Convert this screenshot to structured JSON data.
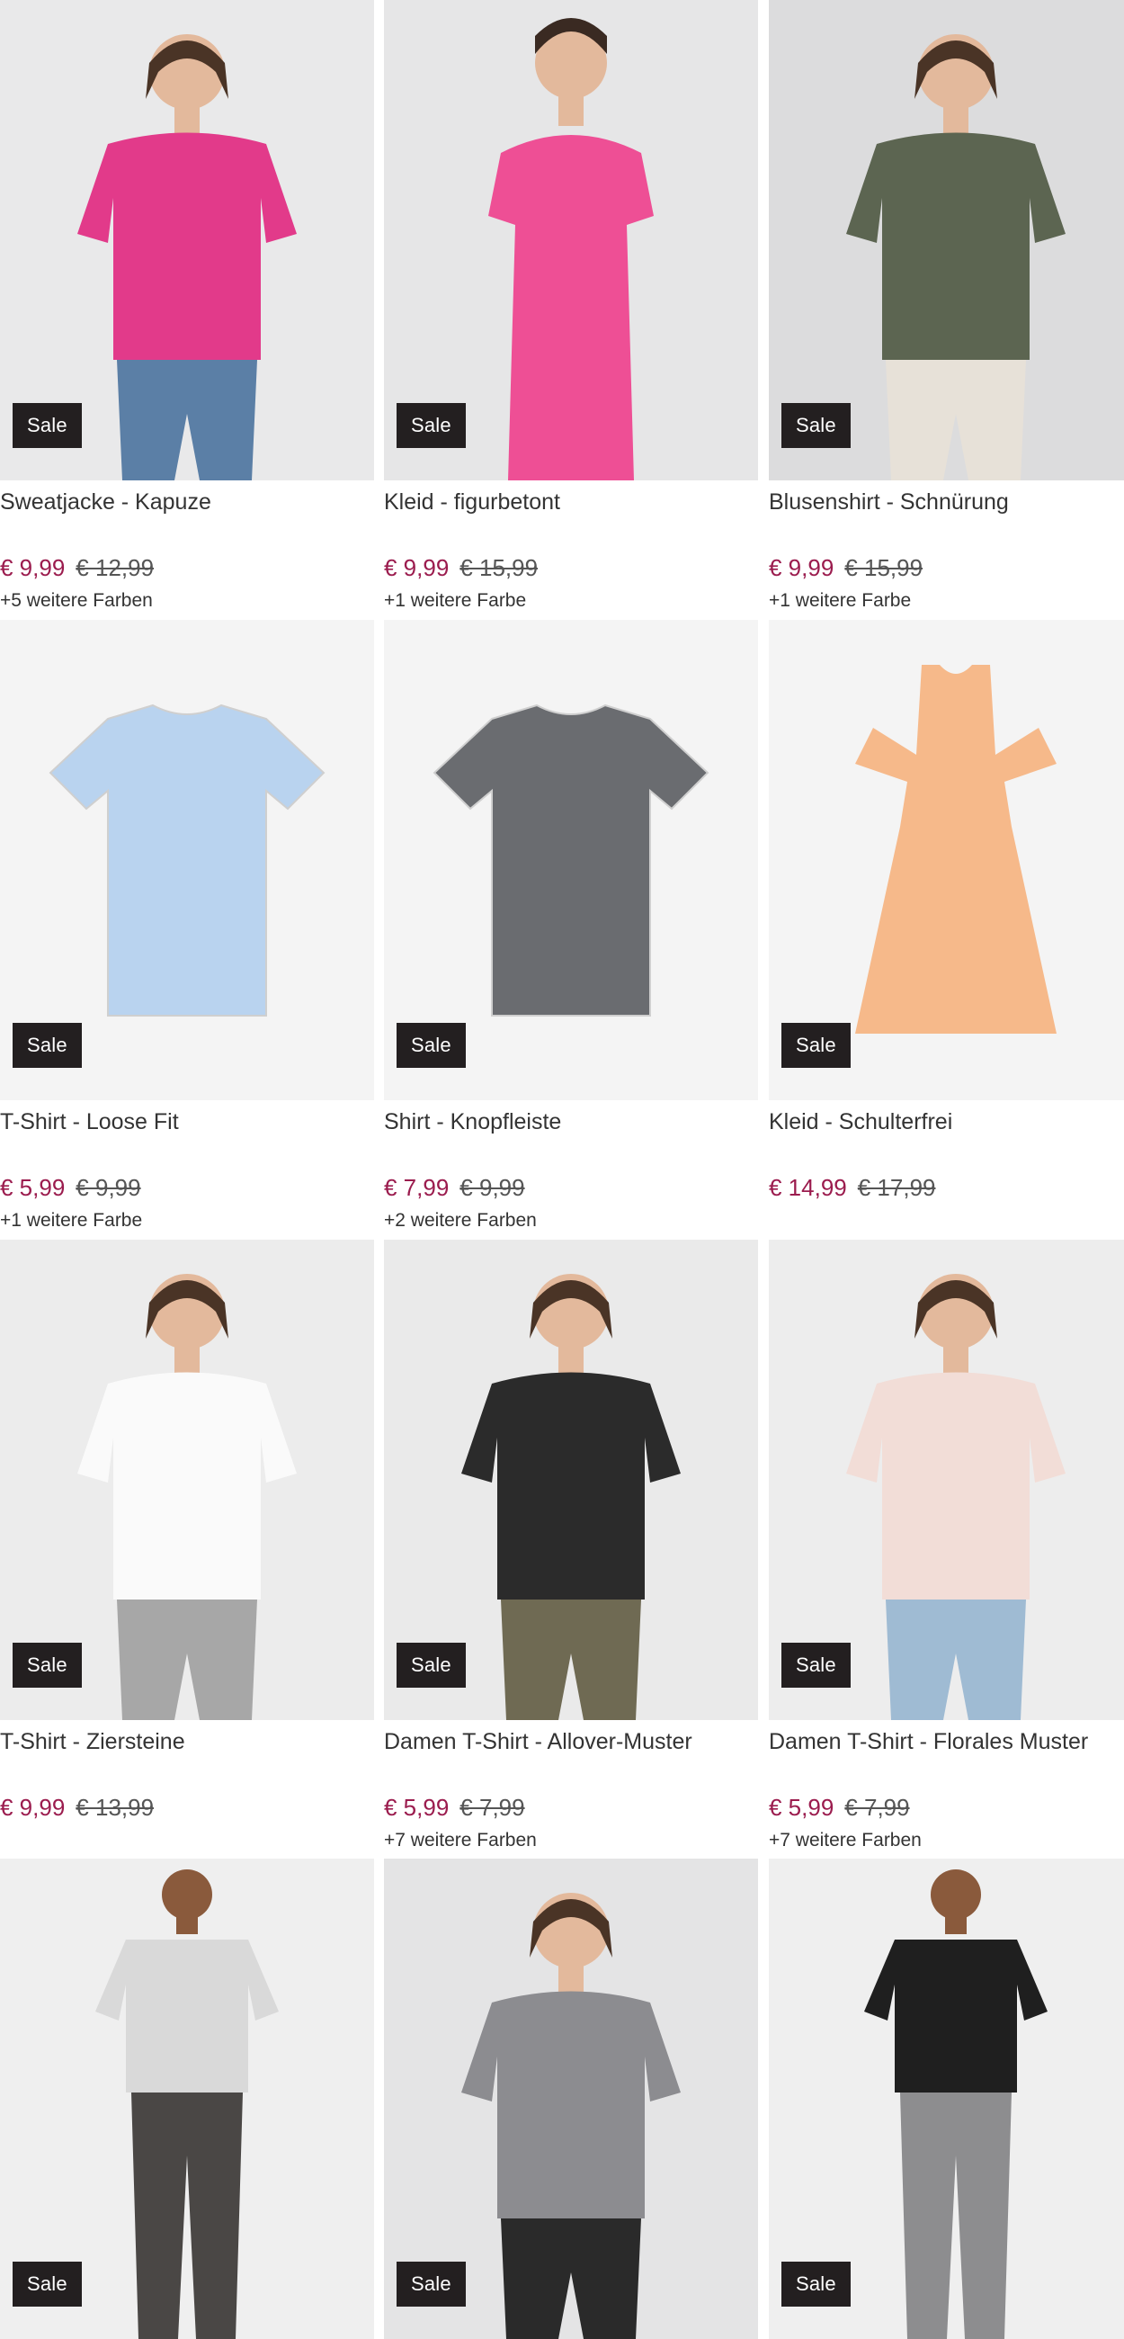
{
  "products": [
    {
      "title": "Sweatjacke - Kapuze",
      "badge": "Sale",
      "price": "€ 9,99",
      "old_price": "€ 12,99",
      "colors": "+5 weitere Farben",
      "image": {
        "bg": "#e9e9ea",
        "garment": "#e23a8a",
        "kind": "jacket",
        "pants": "#5b7fa6"
      }
    },
    {
      "title": "Kleid - figurbetont",
      "badge": "Sale",
      "price": "€ 9,99",
      "old_price": "€ 15,99",
      "colors": "+1 weitere Farbe",
      "image": {
        "bg": "#e6e6e7",
        "garment": "#ee4f95",
        "kind": "dress",
        "pants": ""
      }
    },
    {
      "title": "Blusenshirt - Schnürung",
      "badge": "Sale",
      "price": "€ 9,99",
      "old_price": "€ 15,99",
      "colors": "+1 weitere Farbe",
      "image": {
        "bg": "#dcdcdd",
        "garment": "#5c6551",
        "kind": "top",
        "pants": "#e7e1d8"
      }
    },
    {
      "title": "T-Shirt - Loose Fit",
      "badge": "Sale",
      "price": "€ 5,99",
      "old_price": "€ 9,99",
      "colors": "+1 weitere Farbe",
      "image": {
        "bg": "#f4f4f4",
        "garment": "#b9d3ef",
        "kind": "flat-tee",
        "pants": ""
      }
    },
    {
      "title": "Shirt - Knopfleiste",
      "badge": "Sale",
      "price": "€ 7,99",
      "old_price": "€ 9,99",
      "colors": "+2 weitere Farben",
      "image": {
        "bg": "#f4f4f4",
        "garment": "#6a6c70",
        "kind": "flat-tee",
        "pants": ""
      }
    },
    {
      "title": "Kleid - Schulterfrei",
      "badge": "Sale",
      "price": "€ 14,99",
      "old_price": "€ 17,99",
      "colors": "",
      "image": {
        "bg": "#f4f4f4",
        "garment": "#f6b98a",
        "kind": "flat-dress",
        "pants": ""
      }
    },
    {
      "title": "T-Shirt - Ziersteine",
      "badge": "Sale",
      "price": "€ 9,99",
      "old_price": "€ 13,99",
      "colors": "",
      "image": {
        "bg": "#ececec",
        "garment": "#fafafa",
        "kind": "top",
        "pants": "#a7a7a7"
      }
    },
    {
      "title": "Damen T-Shirt - Allover-Muster",
      "badge": "Sale",
      "price": "€ 5,99",
      "old_price": "€ 7,99",
      "colors": "+7 weitere Farben",
      "image": {
        "bg": "#eaeaea",
        "garment": "#2b2b2b",
        "kind": "top",
        "pants": "#6f6a53"
      }
    },
    {
      "title": "Damen T-Shirt - Florales Muster",
      "badge": "Sale",
      "price": "€ 5,99",
      "old_price": "€ 7,99",
      "colors": "+7 weitere Farben",
      "image": {
        "bg": "#ededed",
        "garment": "#f2ddd7",
        "kind": "top",
        "pants": "#9fbbd3"
      }
    },
    {
      "title": "",
      "badge": "Sale",
      "price": "",
      "old_price": "",
      "colors": "",
      "image": {
        "bg": "#efefef",
        "garment": "#d9d9d9",
        "kind": "man-tee",
        "pants": "#4a4745"
      }
    },
    {
      "title": "",
      "badge": "Sale",
      "price": "",
      "old_price": "",
      "colors": "",
      "image": {
        "bg": "#e4e4e5",
        "garment": "#8c8c90",
        "kind": "top",
        "pants": "#2a2a2a"
      }
    },
    {
      "title": "",
      "badge": "Sale",
      "price": "",
      "old_price": "",
      "colors": "",
      "image": {
        "bg": "#efefef",
        "garment": "#1f1f1f",
        "kind": "man-tee",
        "pants": "#8d8d8f"
      }
    }
  ]
}
